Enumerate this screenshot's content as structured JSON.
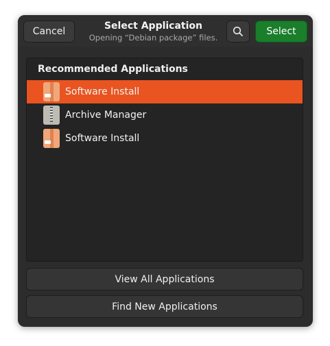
{
  "header": {
    "cancel_label": "Cancel",
    "title": "Select Application",
    "subtitle": "Opening “Debian package” files.",
    "select_label": "Select",
    "search_icon": "search-icon"
  },
  "list": {
    "heading": "Recommended Applications",
    "items": [
      {
        "label": "Software Install",
        "icon": "software-install-icon",
        "selected": true
      },
      {
        "label": "Archive Manager",
        "icon": "archive-manager-icon",
        "selected": false
      },
      {
        "label": "Software Install",
        "icon": "software-install-icon",
        "selected": false
      }
    ]
  },
  "actions": {
    "view_all_label": "View All Applications",
    "find_new_label": "Find New Applications"
  },
  "colors": {
    "accent": "#e95420",
    "select_button": "#1a7e2b",
    "window_bg": "#2c2c2c"
  }
}
